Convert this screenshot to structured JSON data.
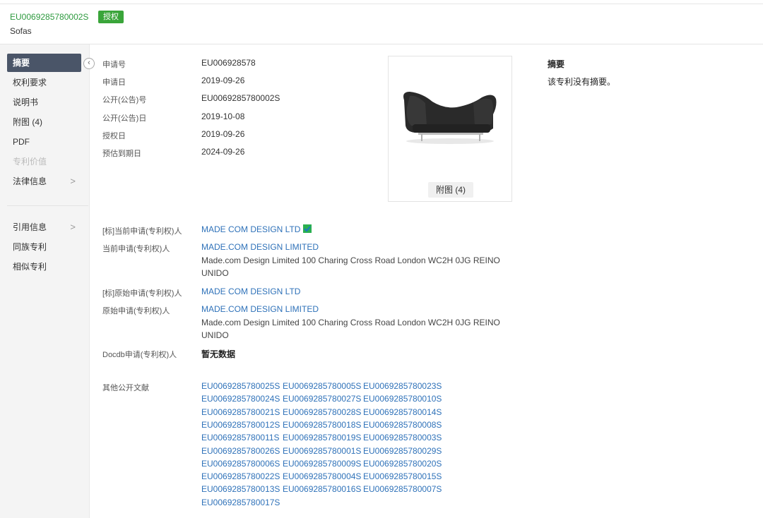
{
  "header": {
    "publication_number": "EU0069285780002S",
    "status_badge": "授权",
    "title": "Sofas"
  },
  "sidebar": {
    "items": [
      {
        "label": "摘要",
        "state": "active"
      },
      {
        "label": "权利要求",
        "state": "normal"
      },
      {
        "label": "说明书",
        "state": "normal"
      },
      {
        "label": "附图 (4)",
        "state": "normal"
      },
      {
        "label": "PDF",
        "state": "normal"
      },
      {
        "label": "专利价值",
        "state": "disabled"
      },
      {
        "label": "法律信息",
        "state": "normal",
        "arrow": ">"
      },
      {
        "label": "引用信息",
        "state": "normal",
        "arrow": ">"
      },
      {
        "label": "同族专利",
        "state": "normal"
      },
      {
        "label": "相似专利",
        "state": "normal"
      }
    ]
  },
  "bib": [
    {
      "label": "申请号",
      "value": "EU006928578"
    },
    {
      "label": "申请日",
      "value": "2019-09-26"
    },
    {
      "label": "公开(公告)号",
      "value": "EU0069285780002S"
    },
    {
      "label": "公开(公告)日",
      "value": "2019-10-08"
    },
    {
      "label": "授权日",
      "value": "2019-09-26"
    },
    {
      "label": "预估到期日",
      "value": "2024-09-26"
    }
  ],
  "figure": {
    "button_label": "附图 (4)"
  },
  "abstract": {
    "title": "摘要",
    "text": "该专利没有摘要。"
  },
  "applicants": {
    "std_current_label": "[标]当前申请(专利权)人",
    "std_current_value": "MADE COM DESIGN LTD",
    "current_label": "当前申请(专利权)人",
    "current_value": "MADE.COM DESIGN LIMITED",
    "current_address_line1": "Made.com Design Limited 100 Charing Cross Road London WC2H 0JG REINO",
    "current_address_line2": "UNIDO",
    "std_original_label": "[标]原始申请(专利权)人",
    "std_original_value": "MADE COM DESIGN LTD",
    "original_label": "原始申请(专利权)人",
    "original_value": "MADE.COM DESIGN LIMITED",
    "original_address_line1": "Made.com Design Limited 100 Charing Cross Road London WC2H 0JG REINO",
    "original_address_line2": "UNIDO",
    "docdb_label": "Docdb申请(专利权)人",
    "docdb_value": "暂无数据"
  },
  "other_docs": {
    "label": "其他公开文献",
    "items": [
      "EU0069285780025S",
      "EU0069285780005S",
      "EU0069285780023S",
      "EU0069285780024S",
      "EU0069285780027S",
      "EU0069285780010S",
      "EU0069285780021S",
      "EU0069285780028S",
      "EU0069285780014S",
      "EU0069285780012S",
      "EU0069285780018S",
      "EU0069285780008S",
      "EU0069285780011S",
      "EU0069285780019S",
      "EU0069285780003S",
      "EU0069285780026S",
      "EU0069285780001S",
      "EU0069285780029S",
      "EU0069285780006S",
      "EU0069285780009S",
      "EU0069285780020S",
      "EU0069285780022S",
      "EU0069285780004S",
      "EU0069285780015S",
      "EU0069285780013S",
      "EU0069285780016S",
      "EU0069285780007S",
      "EU0069285780017S"
    ]
  },
  "colors": {
    "link": "#2f72b9",
    "badge": "#3aa53a",
    "pub_no": "#2e9a3f",
    "active_nav": "#4a5568"
  }
}
